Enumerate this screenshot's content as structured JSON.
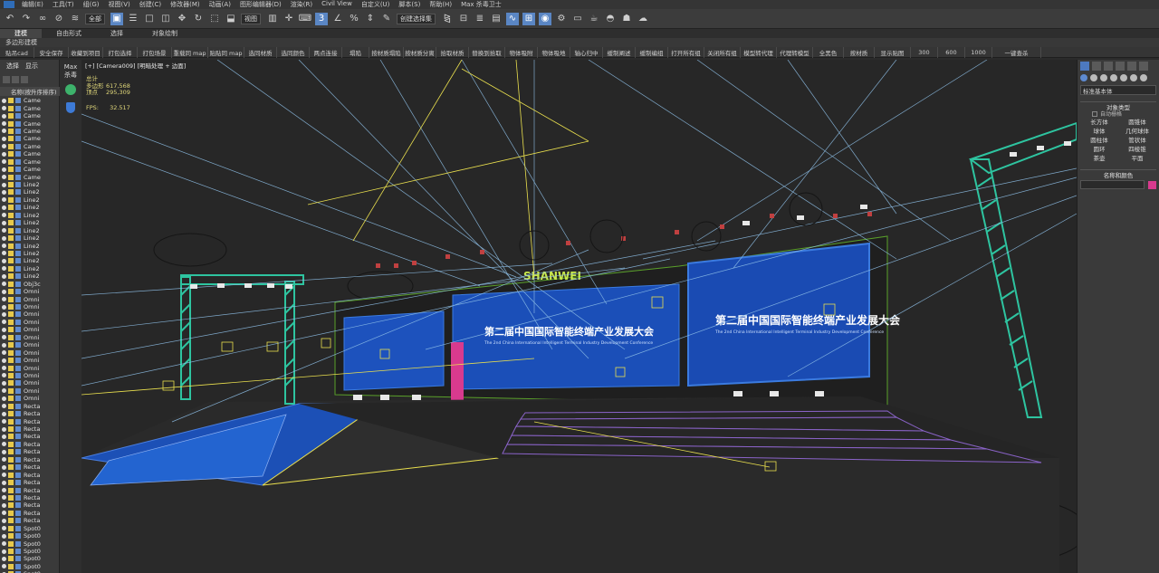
{
  "menubar": {
    "items": [
      "编辑(E)",
      "工具(T)",
      "组(G)",
      "视图(V)",
      "创建(C)",
      "修改器(M)",
      "动画(A)",
      "图形编辑器(D)",
      "渲染(R)",
      "Civil View",
      "自定义(U)",
      "脚本(S)",
      "帮助(H)",
      "Max 杀毒卫士"
    ]
  },
  "toolbar": {
    "selection_filter": "全部",
    "ref_coord": "视图",
    "named_selection": "创建选择集"
  },
  "ribbon": {
    "tabs": [
      "建模",
      "自由形式",
      "选择",
      "对象绘制"
    ],
    "active_tab": "建模",
    "subtitle": "多边形建模"
  },
  "command_bar": {
    "items": [
      "贴吊cad",
      "安全保存",
      "收藏到项目",
      "打包选择",
      "打包场景",
      "重载同 map",
      "贴贴同 map",
      "选同材质",
      "选同颜色",
      "两点连接",
      "塌陷",
      "按材质塌陷",
      "按材质分离",
      "拾取材质",
      "替换到拾取",
      "物体吸附",
      "物体吸地",
      "轴心归中",
      "缓制阐述",
      "缓制编组",
      "打开所有组",
      "关闭所有组",
      "模型转代理",
      "代理转模型",
      "全黑色",
      "按材质",
      "显示贴图",
      "300",
      "600",
      "1000",
      "一键查杀"
    ]
  },
  "left_panel": {
    "tabs": [
      "选择",
      "显示"
    ],
    "header": "名称(按升序排序)",
    "items": [
      "Came",
      "Came",
      "Came",
      "Came",
      "Came",
      "Came",
      "Came",
      "Came",
      "Came",
      "Came",
      "Came",
      "Line2",
      "Line2",
      "Line2",
      "Line2",
      "Line2",
      "Line2",
      "Line2",
      "Line2",
      "Line2",
      "Line2",
      "Line2",
      "Line2",
      "Line2",
      "Obj3c",
      "Omni",
      "Omni",
      "Omni",
      "Omni",
      "Omni",
      "Omni",
      "Omni",
      "Omni",
      "Omni",
      "Omni",
      "Omni",
      "Omni",
      "Omni",
      "Omni",
      "Omni",
      "Recta",
      "Recta",
      "Recta",
      "Recta",
      "Recta",
      "Recta",
      "Recta",
      "Recta",
      "Recta",
      "Recta",
      "Recta",
      "Recta",
      "Recta",
      "Recta",
      "Recta",
      "Recta",
      "Spot0",
      "Spot0",
      "Spot0",
      "Spot0",
      "Spot0",
      "Spot0",
      "Spot0"
    ]
  },
  "viewport_side": {
    "max_label": "Max",
    "kill_label": "杀毒"
  },
  "viewport": {
    "label": "[+] [Camera009] [明暗处理 + 边面]",
    "stats": [
      {
        "label": "总计",
        "value": ""
      },
      {
        "label": "多边形",
        "value": "617,568"
      },
      {
        "label": "顶点",
        "value": "295,309"
      }
    ],
    "fps_label": "FPS:",
    "fps_value": "32.517",
    "stage_logo_text": "SHANWEI",
    "screen_title": "第二届中国国际智能终端产业发展大会",
    "screen_subtitle": "The 2nd China International Intelligent Terminal Industry Development Conference"
  },
  "right_panel": {
    "dropdown": "标准基本体",
    "rollout_object_type": "对象类型",
    "autogrid": "自动栅格",
    "object_buttons": [
      "长方体",
      "圆锥体",
      "球体",
      "几何球体",
      "圆柱体",
      "管状体",
      "圆环",
      "四棱锥",
      "茶壶",
      "平面"
    ],
    "rollout_name_color": "名称和颜色",
    "object_color": "#d83a8e"
  },
  "colors": {
    "truss": "#2ec4a0",
    "screen_blue": "#1b4fb8",
    "rig_lines": "#8fc0e8",
    "light_yellow": "#e9df4e",
    "stage_purple": "#8a63c8"
  }
}
